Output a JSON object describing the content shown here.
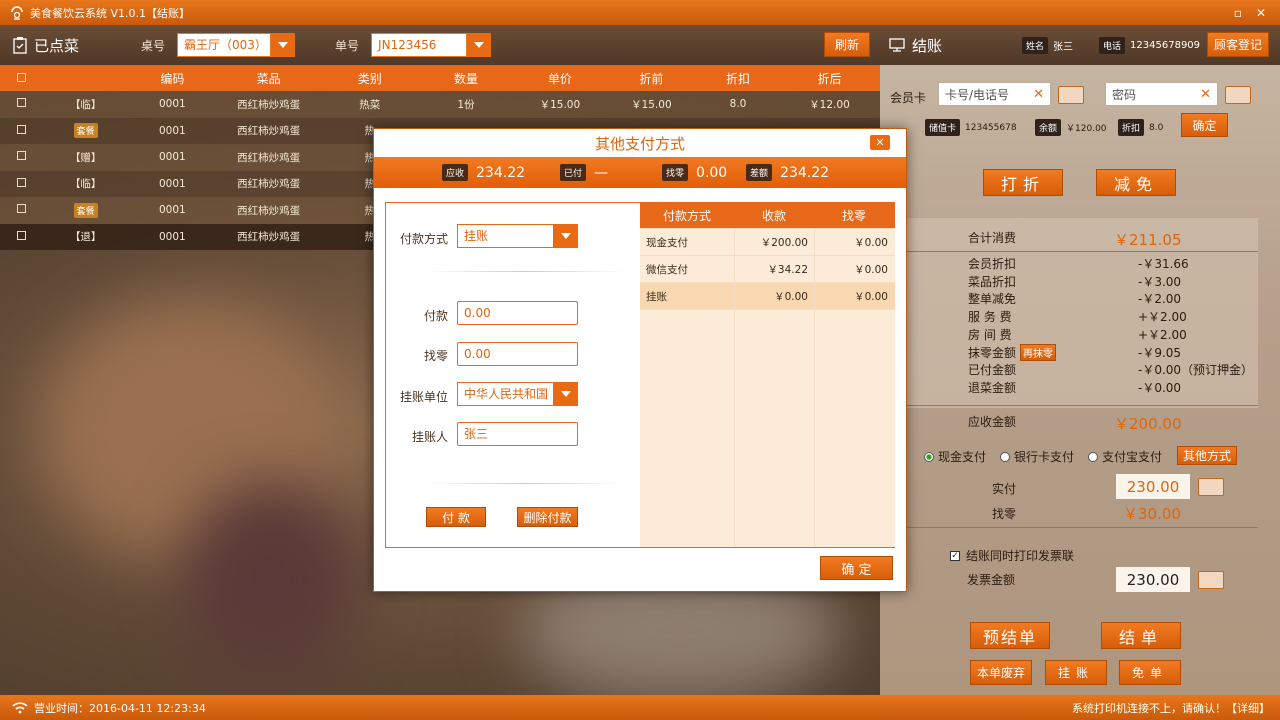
{
  "app": {
    "title": "美食餐饮云系统 V1.0.1【结账】",
    "win_minimize": "▫",
    "win_close": "✕"
  },
  "left": {
    "title": "已点菜",
    "table_label": "桌号",
    "table_value": "霸王厅（003）",
    "order_label": "单号",
    "order_value": "JN123456",
    "refresh_label": "刷新",
    "columns": [
      "□",
      "",
      "编码",
      "菜品",
      "类别",
      "数量",
      "单价",
      "折前",
      "折扣",
      "折后"
    ],
    "rows": [
      {
        "tag": "【临】",
        "tag_style": "text",
        "code": "0001",
        "dish": "西红柿炒鸡蛋",
        "category": "热菜",
        "qty": "1份",
        "price": "￥15.00",
        "before": "￥15.00",
        "discount": "8.0",
        "after": "￥12.00"
      },
      {
        "tag": "套餐",
        "tag_style": "badge",
        "code": "0001",
        "dish": "西红柿炒鸡蛋",
        "category": "热",
        "qty": "",
        "price": "",
        "before": "",
        "discount": "",
        "after": ""
      },
      {
        "tag": "【赠】",
        "tag_style": "text",
        "code": "0001",
        "dish": "西红柿炒鸡蛋",
        "category": "热",
        "qty": "",
        "price": "",
        "before": "",
        "discount": "",
        "after": ""
      },
      {
        "tag": "【临】",
        "tag_style": "text",
        "code": "0001",
        "dish": "西红柿炒鸡蛋",
        "category": "热",
        "qty": "",
        "price": "",
        "before": "",
        "discount": "",
        "after": ""
      },
      {
        "tag": "套餐",
        "tag_style": "badge",
        "code": "0001",
        "dish": "西红柿炒鸡蛋",
        "category": "热",
        "qty": "",
        "price": "",
        "before": "",
        "discount": "",
        "after": ""
      },
      {
        "tag": "【退】",
        "tag_style": "text",
        "code": "0001",
        "dish": "西红柿炒鸡蛋",
        "category": "热",
        "qty": "",
        "price": "",
        "before": "",
        "discount": "",
        "after": ""
      }
    ]
  },
  "right": {
    "title": "结账",
    "name_chip": "姓名",
    "name_value": "张三",
    "phone_chip": "电话",
    "phone_value": "12345678909",
    "register_label": "顾客登记",
    "member_label": "会员卡",
    "card_placeholder": "卡号/电话号",
    "password_placeholder": "密码",
    "stored_chip": "储值卡",
    "stored_value": "123455678",
    "balance_chip": "余额",
    "balance_value": "￥120.00",
    "discount_chip": "折扣",
    "discount_value": "8.0",
    "confirm_label": "确定",
    "discount_btn": "打折",
    "reduce_btn": "减免",
    "total_label": "合计消费",
    "total_value": "￥211.05",
    "lines": [
      {
        "label": "会员折扣",
        "value": "-￥31.66"
      },
      {
        "label": "菜品折扣",
        "value": "-￥3.00"
      },
      {
        "label": "整单减免",
        "value": "-￥2.00"
      },
      {
        "label": "服 务 费",
        "value": "+￥2.00"
      },
      {
        "label": "房 间 费",
        "value": "+￥2.00"
      },
      {
        "label": "抹零金额",
        "value": "-￥9.05"
      },
      {
        "label": "已付金额",
        "value": "-￥0.00（预订押金）"
      },
      {
        "label": "退菜金额",
        "value": "-￥0.00"
      }
    ],
    "rezero_label": "再抹零",
    "receivable_label": "应收金额",
    "receivable_value": "￥200.00",
    "pay_cash": "现金支付",
    "pay_bank": "银行卡支付",
    "pay_alipay": "支付宝支付",
    "pay_other": "其他方式",
    "paid_label": "实付",
    "paid_value": "230.00",
    "change_label": "找零",
    "change_value": "￥30.00",
    "print_invoice_label": "结账同时打印发票联",
    "invoice_label": "发票金额",
    "invoice_value": "230.00",
    "pre_settle_label": "预结单",
    "settle_label": "结单",
    "abandon_label": "本单废弃",
    "credit_label": "挂账",
    "free_label": "免单"
  },
  "modal": {
    "title": "其他支付方式",
    "close": "✕",
    "receivable_chip": "应收",
    "receivable_value": "234.22",
    "paid_chip": "已付",
    "paid_value": "—",
    "change_chip": "找零",
    "change_value": "0.00",
    "diff_chip": "差额",
    "diff_value": "234.22",
    "method_label": "付款方式",
    "method_value": "挂账",
    "pay_label": "付款",
    "pay_value": "0.00",
    "change_label": "找零",
    "unit_label": "挂账单位",
    "unit_value": "中华人民共和国",
    "person_label": "挂账人",
    "person_value": "张三",
    "pay_btn": "付 款",
    "delete_btn": "删除付款",
    "confirm_btn": "确 定",
    "table_headers": [
      "付款方式",
      "收款",
      "找零"
    ],
    "table_rows": [
      {
        "method": "现金支付",
        "amount": "￥200.00",
        "change": "￥0.00"
      },
      {
        "method": "微信支付",
        "amount": "￥34.22",
        "change": "￥0.00"
      },
      {
        "method": "挂账",
        "amount": "￥0.00",
        "change": "￥0.00"
      }
    ]
  },
  "status": {
    "time_label": "营业时间：2016-04-11  12:23:34",
    "warning": "系统打印机连接不上，请确认！【详细】"
  }
}
